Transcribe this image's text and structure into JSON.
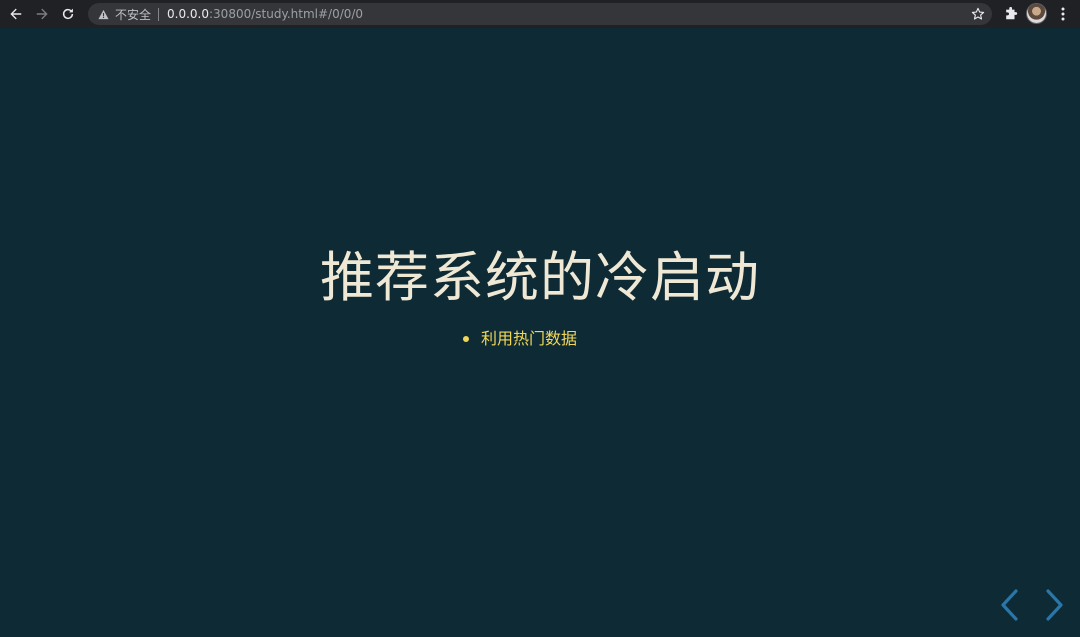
{
  "browser": {
    "insecure_label": "不安全",
    "url_host": "0.0.0.0",
    "url_rest": ":30800/study.html#/0/0/0"
  },
  "slide": {
    "title": "推荐系统的冷启动",
    "bullets": [
      "利用热门数据"
    ]
  },
  "colors": {
    "background": "#0e2a35",
    "title": "#eee8d5",
    "bullet": "#f1d758",
    "nav_arrow": "#2a76a8"
  }
}
